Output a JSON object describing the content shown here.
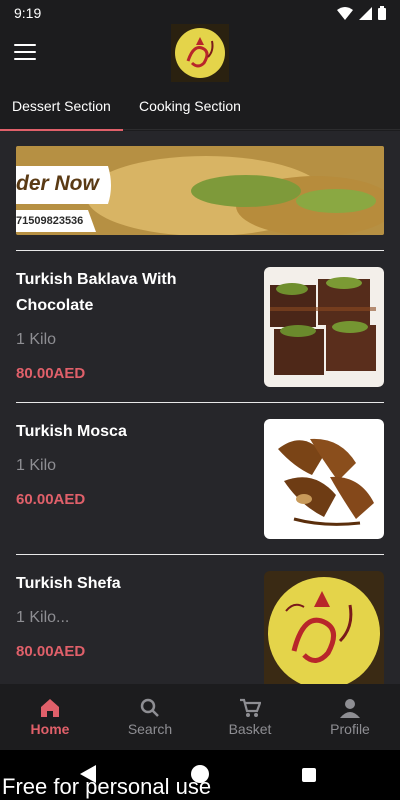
{
  "status_bar": {
    "time": "9:19"
  },
  "tabs": [
    {
      "label": "Dessert Section",
      "active": true
    },
    {
      "label": "Cooking Section",
      "active": false
    }
  ],
  "banner": {
    "text": "der Now",
    "phone": "71509823536"
  },
  "products": [
    {
      "name": "Turkish Baklava With Chocolate",
      "quantity": "1 Kilo",
      "price": "80.00AED"
    },
    {
      "name": "Turkish Mosca",
      "quantity": "1 Kilo",
      "price": "60.00AED"
    },
    {
      "name": "Turkish Shefa",
      "quantity": "1 Kilo...",
      "price": "80.00AED"
    }
  ],
  "bottom_nav": [
    {
      "label": "Home",
      "icon": "home-icon",
      "active": true
    },
    {
      "label": "Search",
      "icon": "search-icon",
      "active": false
    },
    {
      "label": "Basket",
      "icon": "basket-icon",
      "active": false
    },
    {
      "label": "Profile",
      "icon": "profile-icon",
      "active": false
    }
  ],
  "watermark": "Free for personal use",
  "colors": {
    "accent": "#e0606a",
    "background": "#1c1c1e",
    "card": "#26262a",
    "muted": "#8e8e93"
  }
}
